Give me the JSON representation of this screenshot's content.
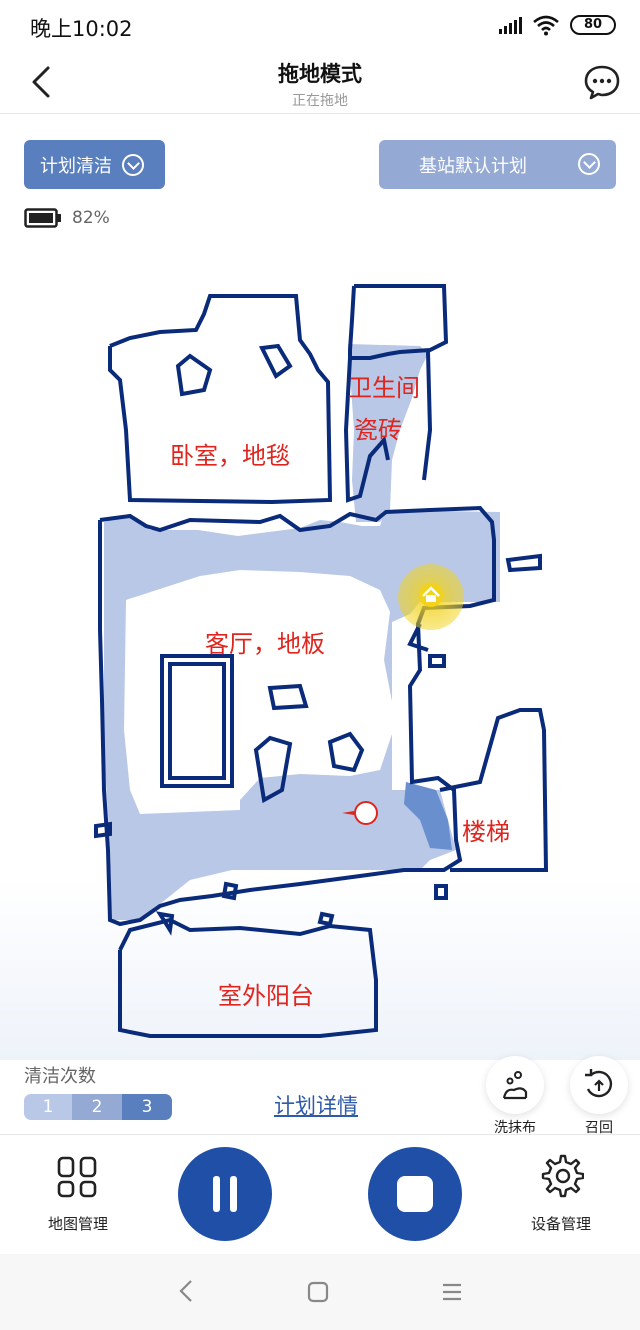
{
  "status_bar": {
    "time": "晚上10:02",
    "battery": "80"
  },
  "header": {
    "title": "拖地模式",
    "subtitle": "正在拖地"
  },
  "controls": {
    "plan_clean": "计划清洁",
    "station_plan": "基站默认计划",
    "battery_percent": "82%"
  },
  "map": {
    "rooms": {
      "bedroom": "卧室，地毯",
      "bathroom_1": "卫生间",
      "bathroom_2": "瓷砖",
      "living": "客厅，地板",
      "stairs": "楼梯",
      "balcony": "室外阳台"
    }
  },
  "clean_count": {
    "label": "清洁次数",
    "options": [
      "1",
      "2",
      "3"
    ],
    "selected": "3"
  },
  "plan_details": "计划详情",
  "quick_actions": {
    "wash_mop": "洗抹布",
    "recall": "召回"
  },
  "bottom": {
    "map_manage": "地图管理",
    "device_manage": "设备管理"
  },
  "colors": {
    "accent": "#1f4fa6",
    "wall": "#0a2a7a",
    "cleaned": "#b8c8e6",
    "label": "#e0241e",
    "base": "#f2d21b"
  }
}
